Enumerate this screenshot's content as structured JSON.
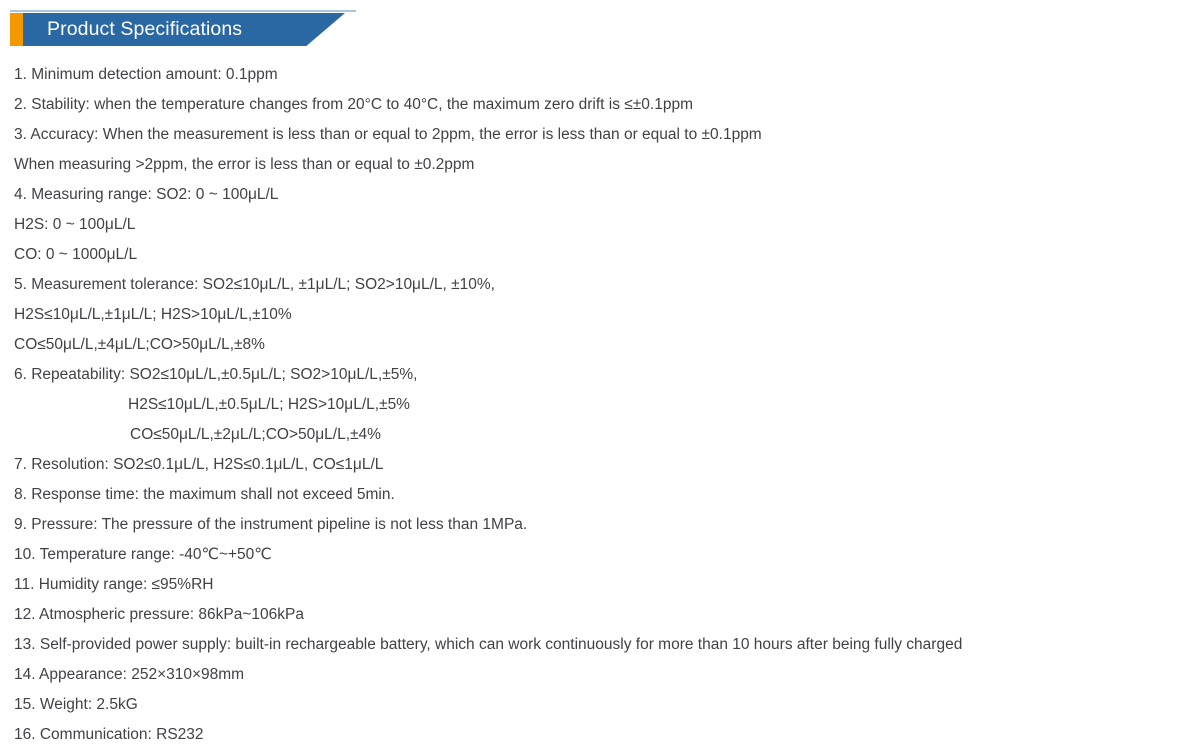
{
  "header": {
    "title": "Product Specifications",
    "accent_color": "#f39800",
    "banner_color": "#2a68a4",
    "topline_color": "#a9c6e0",
    "title_color": "#ffffff"
  },
  "body": {
    "text_color": "#404247",
    "background_color": "#ffffff"
  },
  "specs": [
    {
      "text": "1. Minimum detection amount: 0.1ppm",
      "indent": "none"
    },
    {
      "text": "2. Stability: when the temperature changes from 20°C to 40°C, the maximum zero drift is ≤±0.1ppm",
      "indent": "none"
    },
    {
      "text": "3. Accuracy: When the measurement is less than or equal to 2ppm, the error is less than or equal to ±0.1ppm",
      "indent": "none"
    },
    {
      "text": "When measuring >2ppm, the error is less than or equal to ±0.2ppm",
      "indent": "none"
    },
    {
      "text": "4. Measuring range: SO2: 0 ~ 100μL/L",
      "indent": "none"
    },
    {
      "text": "H2S: 0 ~ 100μL/L",
      "indent": "none"
    },
    {
      "text": "CO: 0 ~ 1000μL/L",
      "indent": "none"
    },
    {
      "text": "5. Measurement tolerance: SO2≤10μL/L, ±1μL/L; SO2>10μL/L, ±10%,",
      "indent": "none"
    },
    {
      "text": "H2S≤10μL/L,±1μL/L; H2S>10μL/L,±10%",
      "indent": "none"
    },
    {
      "text": "CO≤50μL/L,±4μL/L;CO>50μL/L,±8%",
      "indent": "none"
    },
    {
      "text": "6. Repeatability: SO2≤10μL/L,±0.5μL/L; SO2>10μL/L,±5%,",
      "indent": "none"
    },
    {
      "text": "H2S≤10μL/L,±0.5μL/L; H2S>10μL/L,±5%",
      "indent": "a"
    },
    {
      "text": "CO≤50μL/L,±2μL/L;CO>50μL/L,±4%",
      "indent": "b"
    },
    {
      "text": "7. Resolution: SO2≤0.1μL/L, H2S≤0.1μL/L, CO≤1μL/L",
      "indent": "none"
    },
    {
      "text": "8. Response time: the maximum shall not exceed 5min.",
      "indent": "none"
    },
    {
      "text": "9. Pressure: The pressure of the instrument pipeline is not less than 1MPa.",
      "indent": "none"
    },
    {
      "text": "10. Temperature range: -40℃~+50℃",
      "indent": "none"
    },
    {
      "text": "11. Humidity range: ≤95%RH",
      "indent": "none"
    },
    {
      "text": "12. Atmospheric pressure: 86kPa~106kPa",
      "indent": "none"
    },
    {
      "text": "13. Self-provided power supply: built-in rechargeable battery, which can work continuously for more than 10 hours after being fully charged",
      "indent": "none"
    },
    {
      "text": "14. Appearance: 252×310×98mm",
      "indent": "none"
    },
    {
      "text": "15. Weight: 2.5kG",
      "indent": "none"
    },
    {
      "text": "16. Communication: RS232",
      "indent": "none"
    }
  ]
}
